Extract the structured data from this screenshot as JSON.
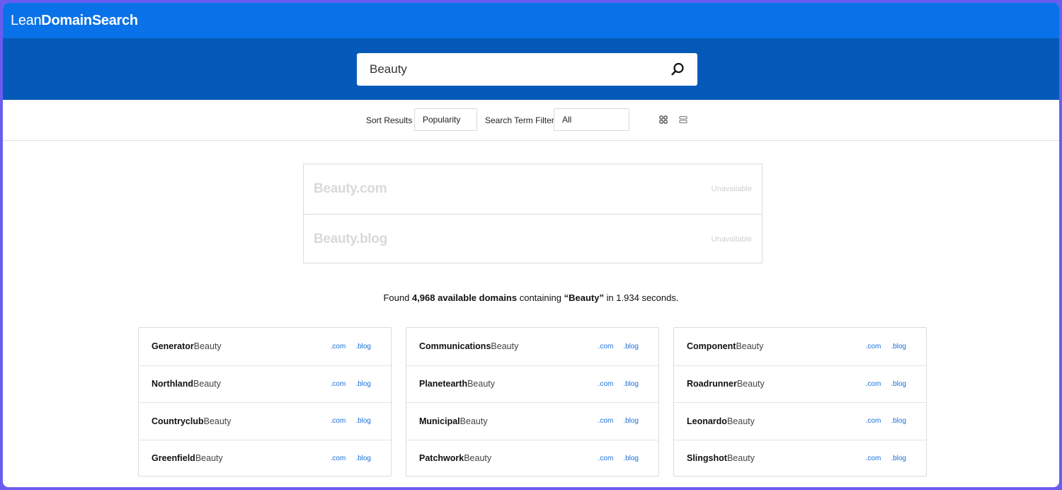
{
  "header": {
    "logo_light": "Lean",
    "logo_bold": "DomainSearch"
  },
  "search": {
    "value": "Beauty",
    "icon": "search-icon"
  },
  "filters": {
    "sort_label": "Sort Results",
    "sort_value": "Popularity",
    "term_label": "Search Term Filter",
    "term_value": "All",
    "view_icons": [
      "grid-view-icon",
      "list-view-icon"
    ]
  },
  "exact_matches": [
    {
      "name": "Beauty.com",
      "status": "Unavailable"
    },
    {
      "name": "Beauty.blog",
      "status": "Unavailable"
    }
  ],
  "summary": {
    "prefix": "Found ",
    "count": "4,968 available domains",
    "middle": " containing ",
    "term": "“Beauty”",
    "suffix": " in 1.934 seconds."
  },
  "results": {
    "suffix": "Beauty",
    "tld_com": ".com",
    "tld_blog": ".blog",
    "columns": [
      [
        "Generator",
        "Northland",
        "Countryclub",
        "Greenfield"
      ],
      [
        "Communications",
        "Planetearth",
        "Municipal",
        "Patchwork"
      ],
      [
        "Component",
        "Roadrunner",
        "Leonardo",
        "Slingshot"
      ]
    ]
  },
  "colors": {
    "topbar": "#0a72e8",
    "searchband": "#0459b9",
    "link": "#1a6fd8",
    "frame": "#6b5cf0"
  }
}
